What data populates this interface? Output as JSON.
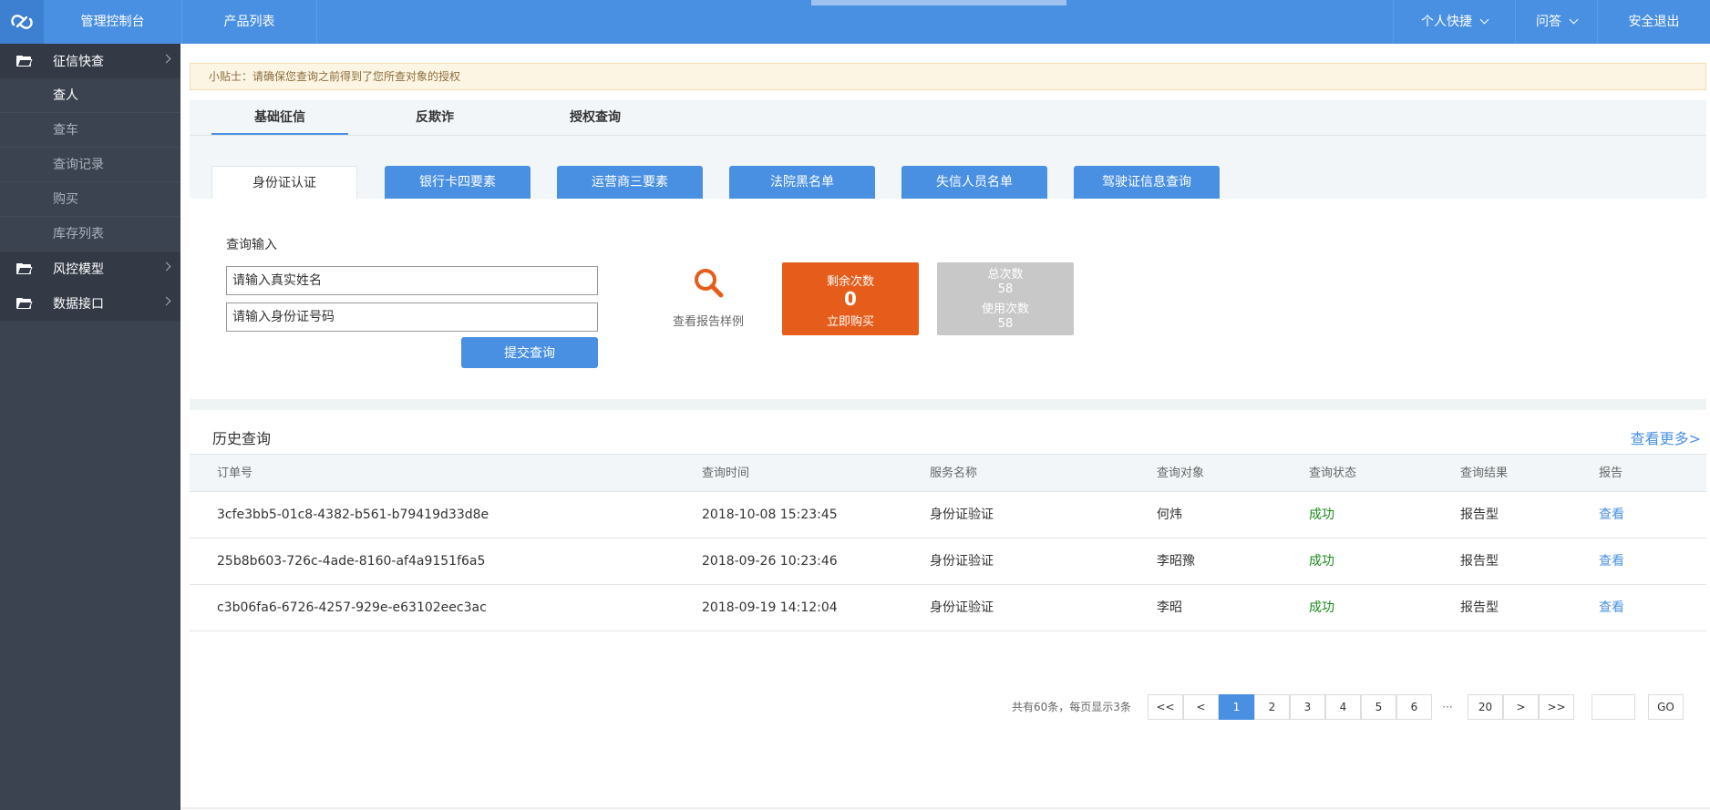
{
  "topbar": {
    "console": "管理控制台",
    "products": "产品列表",
    "shortcuts": "个人快捷",
    "faq": "问答",
    "logout": "安全退出"
  },
  "sidebar": {
    "groups": [
      {
        "label": "征信快查",
        "items": [
          "查人",
          "查车",
          "查询记录",
          "购买",
          "库存列表"
        ]
      },
      {
        "label": "风控模型"
      },
      {
        "label": "数据接口"
      }
    ]
  },
  "tip": "小贴士：请确保您查询之前得到了您所查对象的授权",
  "main_tabs": [
    "基础征信",
    "反欺诈",
    "授权查询"
  ],
  "sub_tabs": [
    "身份证认证",
    "银行卡四要素",
    "运营商三要素",
    "法院黑名单",
    "失信人员名单",
    "驾驶证信息查询"
  ],
  "query": {
    "label": "查询输入",
    "name_placeholder": "请输入真实姓名",
    "id_placeholder": "请输入身份证号码",
    "submit": "提交查询",
    "sample": "查看报告样例"
  },
  "remaining": {
    "label": "剩余次数",
    "value": "0",
    "buy": "立即购买"
  },
  "totals": {
    "total_label": "总次数",
    "total": "58",
    "used_label": "使用次数",
    "used": "58"
  },
  "history": {
    "title": "历史查询",
    "more": "查看更多>",
    "columns": [
      "订单号",
      "查询时间",
      "服务名称",
      "查询对象",
      "查询状态",
      "查询结果",
      "报告"
    ],
    "rows": [
      {
        "order": "3cfe3bb5-01c8-4382-b561-b79419d33d8e",
        "time": "2018-10-08 15:23:45",
        "service": "身份证验证",
        "target": "何炜",
        "status": "成功",
        "result": "报告型",
        "report": "查看"
      },
      {
        "order": "25b8b603-726c-4ade-8160-af4a9151f6a5",
        "time": "2018-09-26 10:23:46",
        "service": "身份证验证",
        "target": "李昭豫",
        "status": "成功",
        "result": "报告型",
        "report": "查看"
      },
      {
        "order": "c3b06fa6-6726-4257-929e-e63102eec3ac",
        "time": "2018-09-19 14:12:04",
        "service": "身份证验证",
        "target": "李昭",
        "status": "成功",
        "result": "报告型",
        "report": "查看"
      }
    ]
  },
  "pagination": {
    "info": "共有60条，每页显示3条",
    "first": "<<",
    "prev": "<",
    "pages": [
      "1",
      "2",
      "3",
      "4",
      "5",
      "6"
    ],
    "ellipsis": "···",
    "last_page": "20",
    "next": ">",
    "last": ">>",
    "go": "GO",
    "current": "1"
  },
  "colors": {
    "primary": "#4a90e2",
    "accent": "#e65c1a",
    "sidebar": "#3b4350",
    "success": "#1a8a1a"
  }
}
